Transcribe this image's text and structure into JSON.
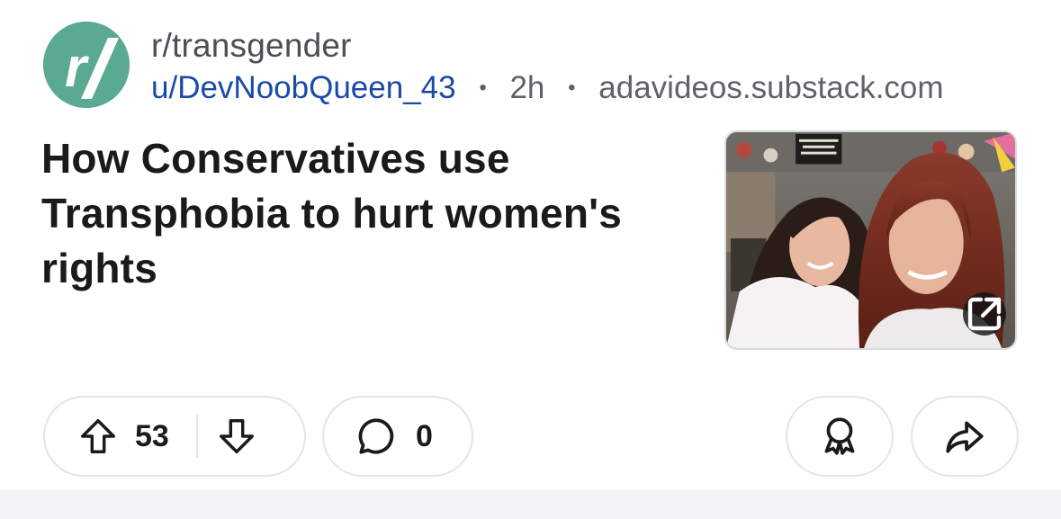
{
  "post": {
    "subreddit": "r/transgender",
    "author": "u/DevNoobQueen_43",
    "separator": "•",
    "age": "2h",
    "domain": "adavideos.substack.com",
    "title": "How Conservatives use Transphobia to hurt women's rights",
    "avatar_icon": "subreddit-r-slash-icon",
    "thumbnail_icon": "external-link-icon"
  },
  "actions": {
    "upvotes": "53",
    "comments": "0",
    "upvote_icon": "arrow-up-icon",
    "downvote_icon": "arrow-down-icon",
    "comment_icon": "comment-bubble-icon",
    "award_icon": "award-icon",
    "share_icon": "share-arrow-icon"
  },
  "colors": {
    "avatar": "#5aaa92",
    "author": "#1a4aa8",
    "text": "#1a1a1b",
    "muted": "#5f6368"
  }
}
